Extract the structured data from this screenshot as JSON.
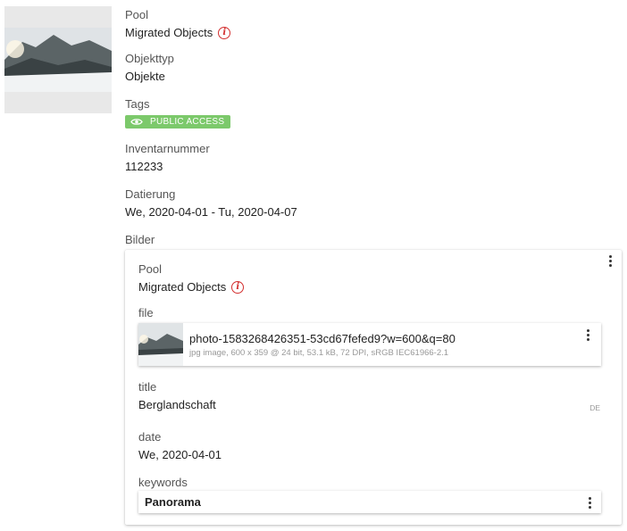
{
  "fields": {
    "pool": {
      "label": "Pool",
      "value": "Migrated Objects"
    },
    "objekttyp": {
      "label": "Objekttyp",
      "value": "Objekte"
    },
    "tags": {
      "label": "Tags",
      "badge": "PUBLIC ACCESS",
      "badge_color": "#7cc96b",
      "icon": "eye-icon"
    },
    "inventarnummer": {
      "label": "Inventarnummer",
      "value": "112233"
    },
    "datierung": {
      "label": "Datierung",
      "value": "We, 2020-04-01 - Tu, 2020-04-07"
    },
    "bilder": {
      "label": "Bilder"
    }
  },
  "bild": {
    "pool": {
      "label": "Pool",
      "value": "Migrated Objects"
    },
    "file": {
      "label": "file",
      "name": "photo-1583268426351-53cd67fefed9?w=600&q=80",
      "meta": "jpg image,  600 x 359 @ 24 bit,  53.1 kB,  72 DPI,  sRGB IEC61966-2.1"
    },
    "title": {
      "label": "title",
      "value": "Berglandschaft",
      "lang": "DE"
    },
    "date": {
      "label": "date",
      "value": "We, 2020-04-01"
    },
    "keywords": {
      "label": "keywords",
      "value": "Panorama"
    }
  },
  "colors": {
    "warning": "#d32f2f",
    "tag": "#7cc96b"
  }
}
